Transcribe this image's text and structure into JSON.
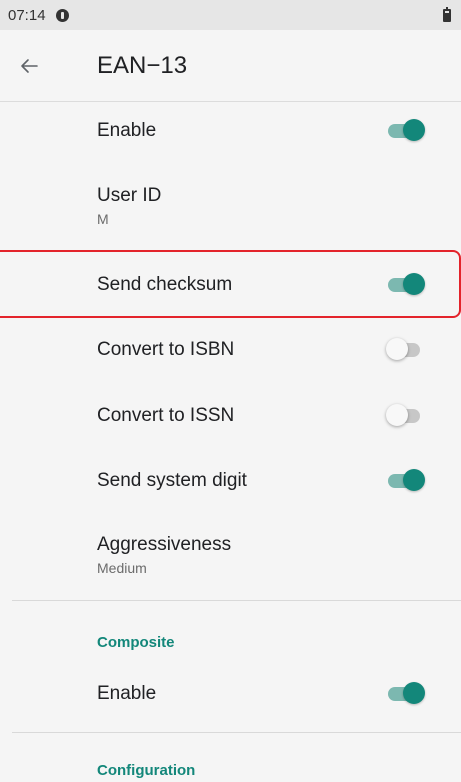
{
  "status_bar": {
    "time": "07:14"
  },
  "app_bar": {
    "title": "EAN−13"
  },
  "items": [
    {
      "title": "Enable",
      "toggle": true
    },
    {
      "title": "User ID",
      "summary": "M"
    },
    {
      "title": "Send checksum",
      "toggle": true
    },
    {
      "title": "Convert to ISBN",
      "toggle": false
    },
    {
      "title": "Convert to ISSN",
      "toggle": false
    },
    {
      "title": "Send system digit",
      "toggle": true
    },
    {
      "title": "Aggressiveness",
      "summary": "Medium"
    }
  ],
  "composite": {
    "header": "Composite",
    "enable": {
      "title": "Enable",
      "toggle": true
    }
  },
  "configuration": {
    "header": "Configuration"
  },
  "colors": {
    "accent": "#13877a",
    "highlight": "#e3232b"
  }
}
